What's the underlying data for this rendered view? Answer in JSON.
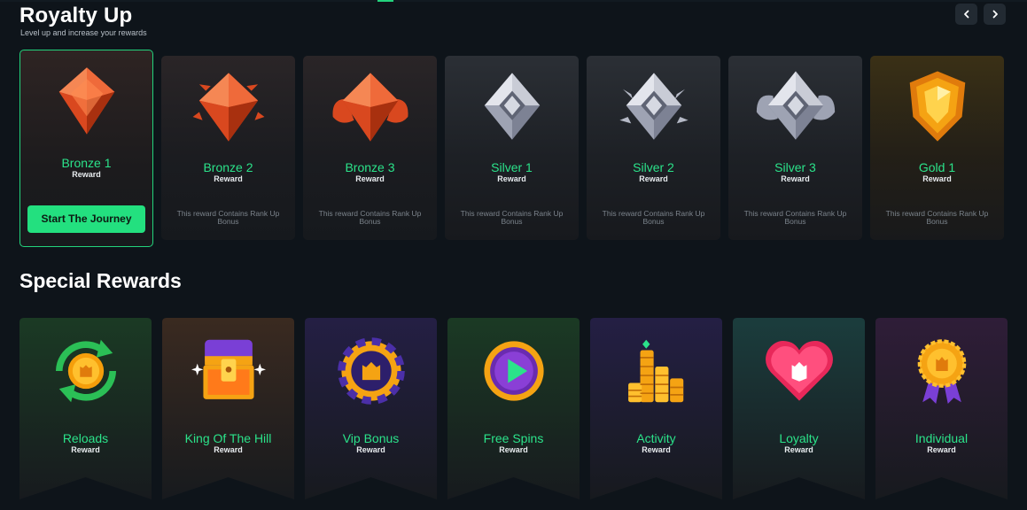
{
  "header": {
    "title": "Royalty Up",
    "subtitle": "Level up and increase your rewards"
  },
  "nav": {
    "prev_icon": "chevron-left-icon",
    "next_icon": "chevron-right-icon"
  },
  "ranks": [
    {
      "name": "Bronze 1",
      "reward": "Reward",
      "button": "Start The Journey",
      "tier": "bronze"
    },
    {
      "name": "Bronze 2",
      "reward": "Reward",
      "desc": "This reward Contains Rank Up Bonus",
      "tier": "bronze"
    },
    {
      "name": "Bronze 3",
      "reward": "Reward",
      "desc": "This reward Contains Rank Up Bonus",
      "tier": "bronze"
    },
    {
      "name": "Silver 1",
      "reward": "Reward",
      "desc": "This reward Contains Rank Up Bonus",
      "tier": "silver"
    },
    {
      "name": "Silver 2",
      "reward": "Reward",
      "desc": "This reward Contains Rank Up Bonus",
      "tier": "silver"
    },
    {
      "name": "Silver 3",
      "reward": "Reward",
      "desc": "This reward Contains Rank Up Bonus",
      "tier": "silver"
    },
    {
      "name": "Gold 1",
      "reward": "Reward",
      "desc": "This reward Contains Rank Up Bonus",
      "tier": "gold"
    }
  ],
  "special": {
    "title": "Special Rewards",
    "items": [
      {
        "name": "Reloads",
        "reward": "Reward",
        "icon": "reload-coin-icon"
      },
      {
        "name": "King Of The Hill",
        "reward": "Reward",
        "icon": "treasure-chest-icon"
      },
      {
        "name": "Vip Bonus",
        "reward": "Reward",
        "icon": "vip-chip-icon"
      },
      {
        "name": "Free Spins",
        "reward": "Reward",
        "icon": "play-coin-icon"
      },
      {
        "name": "Activity",
        "reward": "Reward",
        "icon": "coin-stacks-icon"
      },
      {
        "name": "Loyalty",
        "reward": "Reward",
        "icon": "heart-icon"
      },
      {
        "name": "Individual",
        "reward": "Reward",
        "icon": "medal-icon"
      }
    ]
  },
  "colors": {
    "accent": "#23e07f",
    "accent_text": "#2be38a",
    "background": "#0e141a",
    "bronze": "#e8562a",
    "silver": "#9ea3b3",
    "gold": "#f5a313"
  }
}
